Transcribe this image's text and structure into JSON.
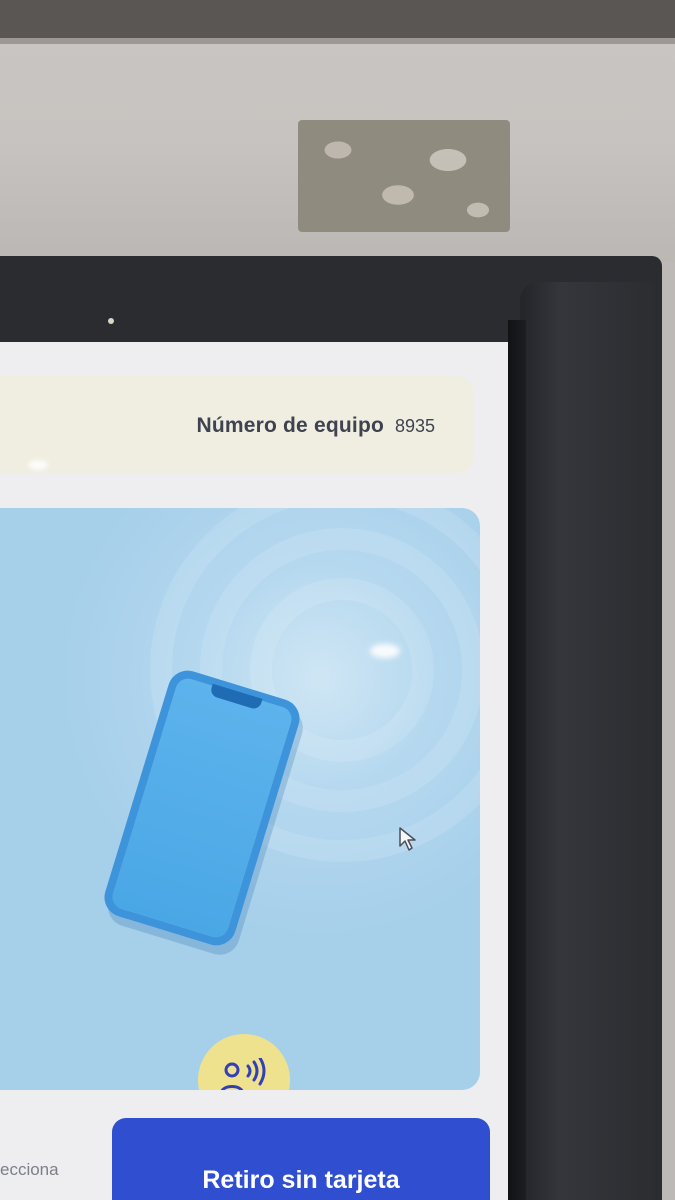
{
  "header": {
    "equipo_label": "Número de equipo",
    "equipo_number": "8935"
  },
  "main": {
    "illustration": {
      "phone_icon": "smartphone-icon",
      "badge_icon": "contactless-user-icon",
      "badge_color": "#efe28f"
    },
    "cursor_icon": "mouse-pointer-icon"
  },
  "footer": {
    "left_text": "ecciona",
    "retiro_button": "Retiro sin tarjeta",
    "button_color": "#2f4fd0"
  }
}
